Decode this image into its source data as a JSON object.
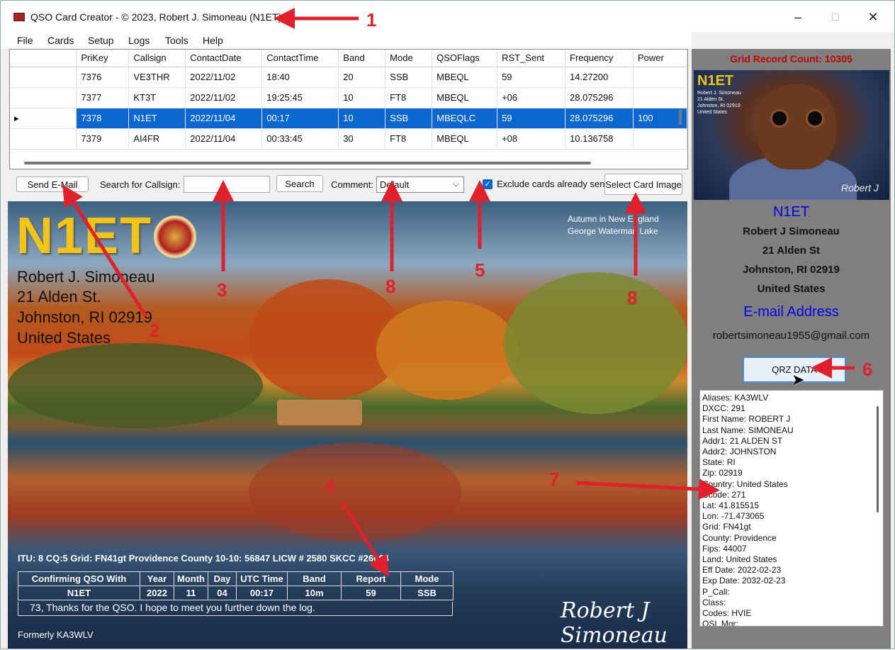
{
  "window": {
    "title": "QSO Card Creator - © 2023, Robert J. Simoneau (N1ET)",
    "controls": [
      "–",
      "☐",
      "✕"
    ]
  },
  "menu": [
    "File",
    "Cards",
    "Setup",
    "Logs",
    "Tools",
    "Help"
  ],
  "grid": {
    "columns": [
      "",
      "PriKey",
      "Callsign",
      "ContactDate",
      "ContactTime",
      "Band",
      "Mode",
      "QSOFlags",
      "RST_Sent",
      "Frequency",
      "Power"
    ],
    "rows": [
      [
        "",
        "7376",
        "VE3THR",
        "2022/11/02",
        "18:40",
        "20",
        "SSB",
        "MBEQL",
        "59",
        "14.27200",
        ""
      ],
      [
        "",
        "7377",
        "KT3T",
        "2022/11/02",
        "19:25:45",
        "10",
        "FT8",
        "MBEQL",
        "+06",
        "28.075296",
        ""
      ],
      [
        "▸",
        "7378",
        "N1ET",
        "2022/11/04",
        "00:17",
        "10",
        "SSB",
        "MBEQLC",
        "59",
        "28.075296",
        "100"
      ],
      [
        "",
        "7379",
        "AI4FR",
        "2022/11/04",
        "00:33:45",
        "30",
        "FT8",
        "MBEQL",
        "+08",
        "10.136758",
        ""
      ]
    ]
  },
  "toolbar": {
    "send_email": "Send E-Mail",
    "search_label": "Search for Callsign:",
    "search_value": "",
    "search_button": "Search",
    "comment_label": "Comment:",
    "comment_value": "Default",
    "exclude_label": "Exclude cards already sent",
    "exclude_checked": true,
    "select_image": "Select Card Image"
  },
  "card": {
    "callsign": "N1ET",
    "address": [
      "Robert J. Simoneau",
      "21 Alden St.",
      "Johnston, RI 02919",
      "United States"
    ],
    "photo_note": [
      "Autumn in New England",
      "George Waterman Lake"
    ],
    "itu_line": "ITU: 8 CQ:5 Grid: FN41gt Providence County 10-10: 56847 LICW # 2580 SKCC #26064",
    "table_headers": [
      "Confirming QSO With",
      "Year",
      "Month",
      "Day",
      "UTC Time",
      "Band",
      "Report",
      "Mode"
    ],
    "table_values": [
      "N1ET",
      "2022",
      "11",
      "04",
      "00:17",
      "10m",
      "59",
      "SSB"
    ],
    "thanks": "73, Thanks for the QSO. I hope to meet you further down the log.",
    "formerly": "Formerly KA3WLV",
    "signature": "Robert J Simoneau"
  },
  "right_panel": {
    "grid_count": "Grid Record Count: 10305",
    "photo_call": "N1ET",
    "photo_addr": [
      "Robert J. Simoneau",
      "21 Alden St.",
      "Johnston, RI 02919",
      "United States"
    ],
    "photo_sig": "Robert J",
    "callsign": "N1ET",
    "name": "Robert J Simoneau",
    "street": "21 Alden St",
    "city": "Johnston, RI 02919",
    "country": "United States",
    "email_heading": "E-mail Address",
    "email": "robertsimoneau1955@gmail.com",
    "qrz_button": "QRZ DATA",
    "qrz_lines": [
      "Aliases: KA3WLV",
      "DXCC: 291",
      "First Name: ROBERT J",
      "Last Name: SIMONEAU",
      "Addr1: 21 ALDEN ST",
      "Addr2: JOHNSTON",
      "State: RI",
      "Zip: 02919",
      "Country: United States",
      "Ccode: 271",
      "Lat: 41.815515",
      "Lon: -71.473065",
      "Grid: FN41gt",
      "County: Providence",
      "Fips: 44007",
      "Land: United States",
      "Eff Date: 2022-02-23",
      "Exp Date: 2032-02-23",
      "P_Call:",
      "Class:",
      "Codes: HVIE",
      "QSL Mgr:"
    ]
  },
  "annotations": [
    "1",
    "2",
    "3",
    "4",
    "5",
    "6",
    "7",
    "8",
    "8"
  ],
  "colors": {
    "selection": "#0a67d0",
    "annotation": "#e0202a",
    "callsign_yellow": "#f2c418",
    "link_blue": "#0000ee",
    "count_red": "#c00000"
  }
}
